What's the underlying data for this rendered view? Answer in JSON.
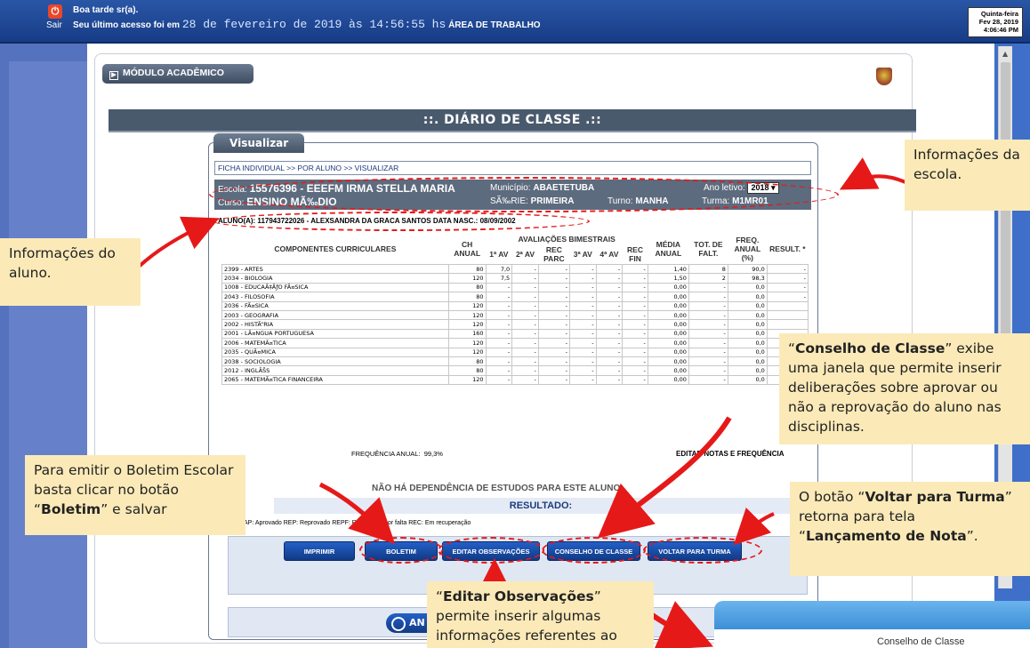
{
  "topbar": {
    "sair_label": "Sair",
    "greeting": "Boa tarde sr(a).",
    "last_access_prefix": "Seu último acesso foi em",
    "last_access_datetime": "28 de fevereiro de 2019 às 14:56:55 hs",
    "last_access_suffix": "ÁREA DE TRABALHO",
    "weekday": "Quinta-feira",
    "date": "Fev 28, 2019",
    "time": "4:06:46 PM"
  },
  "module": {
    "label": "MÓDULO ACADÊMICO"
  },
  "page_title": "::. DIÁRIO DE CLASSE .::",
  "card": {
    "tab_label": "Visualizar",
    "breadcrumb": "FICHA INDIVIDUAL >> POR ALUNO >> VISUALIZAR"
  },
  "escola": {
    "escola_label": "Escola:",
    "escola_value": "15576396 - EEEFM IRMA STELLA MARIA",
    "municipio_label": "Município:",
    "municipio_value": "ABAETETUBA",
    "ano_label": "Ano letivo:",
    "ano_value": "2018",
    "curso_label": "Curso:",
    "curso_value": "ENSINO MÃ‰DIO",
    "serie_label": "SÃ‰RIE:",
    "serie_value": "PRIMEIRA",
    "turno_label": "Turno:",
    "turno_value": "MANHA",
    "turma_label": "Turma:",
    "turma_value": "M1MR01"
  },
  "aluno_line": "ALUNO(A): 117943722026 - ALEXSANDRA DA GRACA SANTOS  DATA NASC.: 08/09/2002",
  "table": {
    "headers": {
      "componentes": "COMPONENTES CURRICULARES",
      "ch": "CH ANUAL",
      "avaliacoes": "AVALIAÇÕES BIMESTRAIS",
      "av1": "1ª AV",
      "av2": "2ª AV",
      "rec_parc": "REC PARC",
      "av3": "3ª AV",
      "av4": "4ª AV",
      "rec_fin": "REC FIN",
      "media": "MÉDIA ANUAL",
      "tot_falt": "TOT. DE FALT.",
      "freq": "FREQ. ANUAL (%)",
      "result": "RESULT. *"
    },
    "rows": [
      [
        "2399 - ARTES",
        "80",
        "7,0",
        "-",
        "-",
        "-",
        "-",
        "-",
        "1,40",
        "8",
        "90,0",
        "-"
      ],
      [
        "2034 - BIOLOGIA",
        "120",
        "7,5",
        "-",
        "-",
        "-",
        "-",
        "-",
        "1,50",
        "2",
        "98,3",
        "-"
      ],
      [
        "1008 - EDUCAÃ‡ÃƒO FÃ¤SICA",
        "80",
        "-",
        "-",
        "-",
        "-",
        "-",
        "-",
        "0,00",
        "-",
        "0,0",
        "-"
      ],
      [
        "2043 - FILOSOFIA",
        "80",
        "-",
        "-",
        "-",
        "-",
        "-",
        "-",
        "0,00",
        "-",
        "0,0",
        "-"
      ],
      [
        "2036 - FÃ¤SICA",
        "120",
        "-",
        "-",
        "-",
        "-",
        "-",
        "-",
        "0,00",
        "-",
        "0,0",
        ""
      ],
      [
        "2003 - GEOGRAFIA",
        "120",
        "-",
        "-",
        "-",
        "-",
        "-",
        "-",
        "0,00",
        "-",
        "0,0",
        ""
      ],
      [
        "2002 - HISTÃ“RIA",
        "120",
        "-",
        "-",
        "-",
        "-",
        "-",
        "-",
        "0,00",
        "-",
        "0,0",
        ""
      ],
      [
        "2001 - LÃ¤NGUA PORTUGUESA",
        "160",
        "-",
        "-",
        "-",
        "-",
        "-",
        "-",
        "0,00",
        "-",
        "0,0",
        ""
      ],
      [
        "2006 - MATEMÃ¤TICA",
        "120",
        "-",
        "-",
        "-",
        "-",
        "-",
        "-",
        "0,00",
        "-",
        "0,0",
        ""
      ],
      [
        "2035 - QUÃ¤MICA",
        "120",
        "-",
        "-",
        "-",
        "-",
        "-",
        "-",
        "0,00",
        "-",
        "0,0",
        ""
      ],
      [
        "2038 - SOCIOLOGIA",
        "80",
        "-",
        "-",
        "-",
        "-",
        "-",
        "-",
        "0,00",
        "-",
        "0,0",
        ""
      ],
      [
        "2012 - INGLÃŠS",
        "80",
        "-",
        "-",
        "-",
        "-",
        "-",
        "-",
        "0,00",
        "-",
        "0,0",
        ""
      ],
      [
        "2065 - MATEMÃ¤TICA FINANCEIRA",
        "120",
        "-",
        "-",
        "-",
        "-",
        "-",
        "-",
        "0,00",
        "-",
        "0,0",
        ""
      ]
    ]
  },
  "freq_anual_label": "FREQUÊNCIA ANUAL:",
  "freq_anual_value": "99,3%",
  "editar_notas_label": "EDITAR NOTAS E FREQUÊNCIA",
  "dependencia_text": "NÃO HÁ DEPENDÊNCIA DE ESTUDOS PARA ESTE ALUNO",
  "resultado_label": "RESULTADO:",
  "legend_text": "AP: Aprovado   REP: Reprovado   REPF: Reprovado por falta   REC: Em recuperação",
  "buttons": {
    "imprimir": "IMPRIMIR",
    "boletim": "BOLETIM",
    "editar_obs": "EDITAR OBSERVAÇÕES",
    "conselho": "CONSELHO DE CLASSE",
    "voltar": "VOLTAR PARA TURMA",
    "bottom": "AN"
  },
  "conselho_window_title": "Conselho de Classe",
  "annotations": {
    "escola_note": "Informações da escola.",
    "aluno_note": "Informações do aluno.",
    "conselho_note_q1": "“",
    "conselho_note_bold": "Conselho de Classe",
    "conselho_note_rest": "” exibe uma janela que permite inserir deliberações sobre aprovar ou não a reprovação do aluno nas disciplinas.",
    "boletim_note_start": "Para emitir o Boletim Escolar basta clicar no botão “",
    "boletim_note_bold": "Boletim",
    "boletim_note_end": "” e salvar",
    "voltar_note_q1": "O botão “",
    "voltar_note_bold1": "Voltar para Turma",
    "voltar_note_mid": "” retorna para tela “",
    "voltar_note_bold2": "Lançamento de Nota",
    "voltar_note_end": "”.",
    "editar_note_q1": "“",
    "editar_note_bold": "Editar Observações",
    "editar_note_rest": "” permite inserir algumas informações referentes ao aluno"
  },
  "colors": {
    "topbar": "#1f4a98",
    "annotation_bg": "#fbeab8",
    "annotation_red": "#e61919",
    "button": "#1a4ea8"
  }
}
